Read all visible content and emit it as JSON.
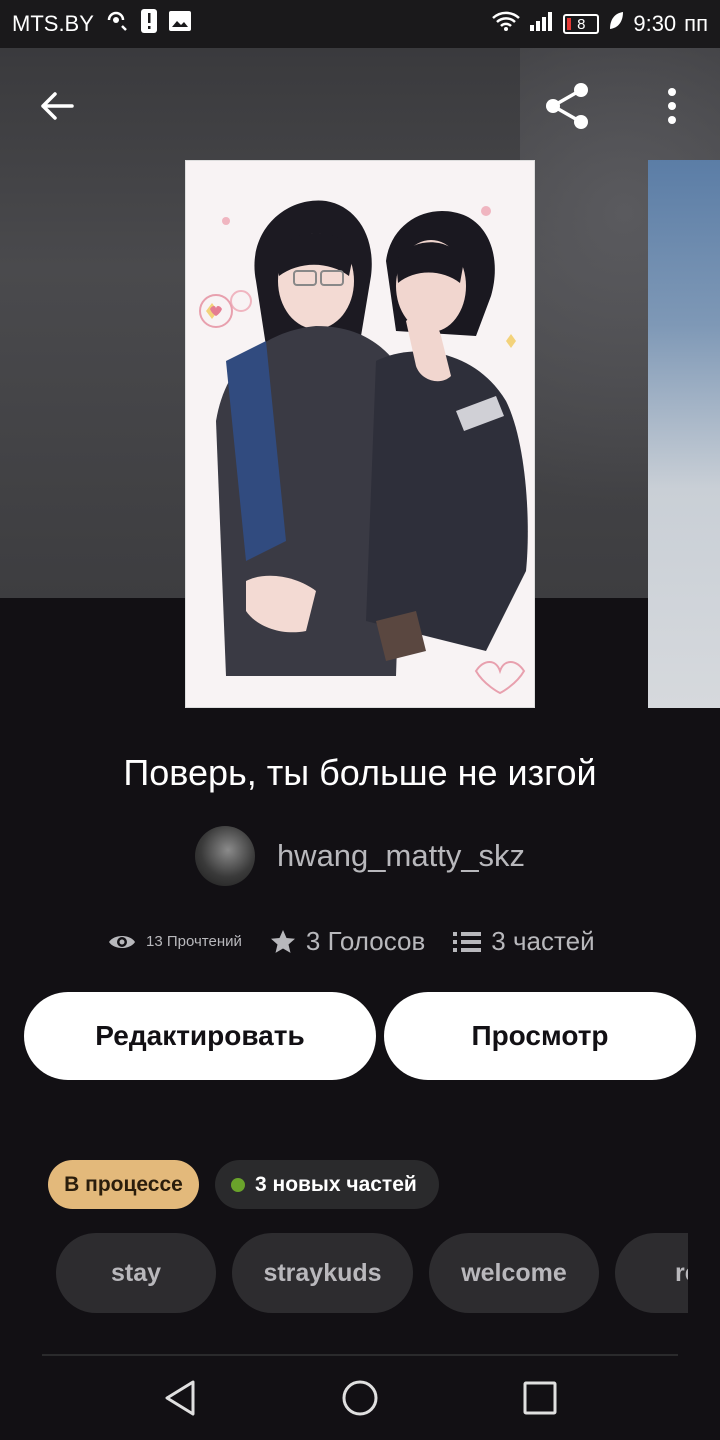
{
  "status_bar": {
    "carrier": "MTS.BY",
    "battery": "8",
    "time": "9:30",
    "network_suffix": "пп"
  },
  "story": {
    "title": "Поверь, ты больше не изгой",
    "author": "hwang_matty_skz",
    "reads": "13 Прочтений",
    "votes": "3 Голосов",
    "parts": "3 частей"
  },
  "actions": {
    "edit_label": "Редактировать",
    "preview_label": "Просмотр"
  },
  "badges": {
    "status": "В процессе",
    "new_parts": "3 новых частей"
  },
  "tags": [
    "stay",
    "straykuds",
    "welcome",
    "re"
  ],
  "colors": {
    "background": "#121014",
    "status_badge": "#e3b97b",
    "new_dot": "#6aa32b",
    "tag_bg": "#2d2c2f"
  },
  "icons": {
    "back": "arrow-left-icon",
    "share": "share-icon",
    "more": "more-vert-icon",
    "views": "eye-icon",
    "votes": "star-icon",
    "parts": "list-icon"
  }
}
